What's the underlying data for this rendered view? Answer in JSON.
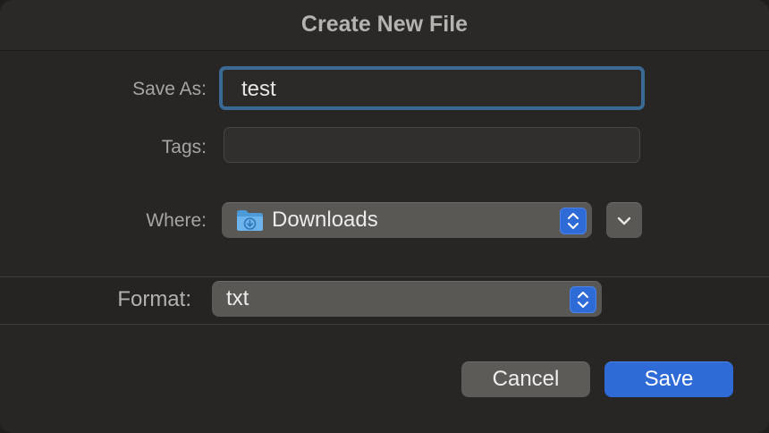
{
  "dialog": {
    "title": "Create New File"
  },
  "save_as": {
    "label": "Save As:",
    "value": "test"
  },
  "tags": {
    "label": "Tags:",
    "value": ""
  },
  "where": {
    "label": "Where:",
    "selected": "Downloads",
    "icon": "downloads-folder-icon"
  },
  "format": {
    "label": "Format:",
    "selected": "txt"
  },
  "buttons": {
    "cancel_label": "Cancel",
    "save_label": "Save"
  },
  "colors": {
    "accent": "#2f6bd6",
    "focus_ring": "#3a6a93",
    "folder": "#5aa8e6"
  }
}
